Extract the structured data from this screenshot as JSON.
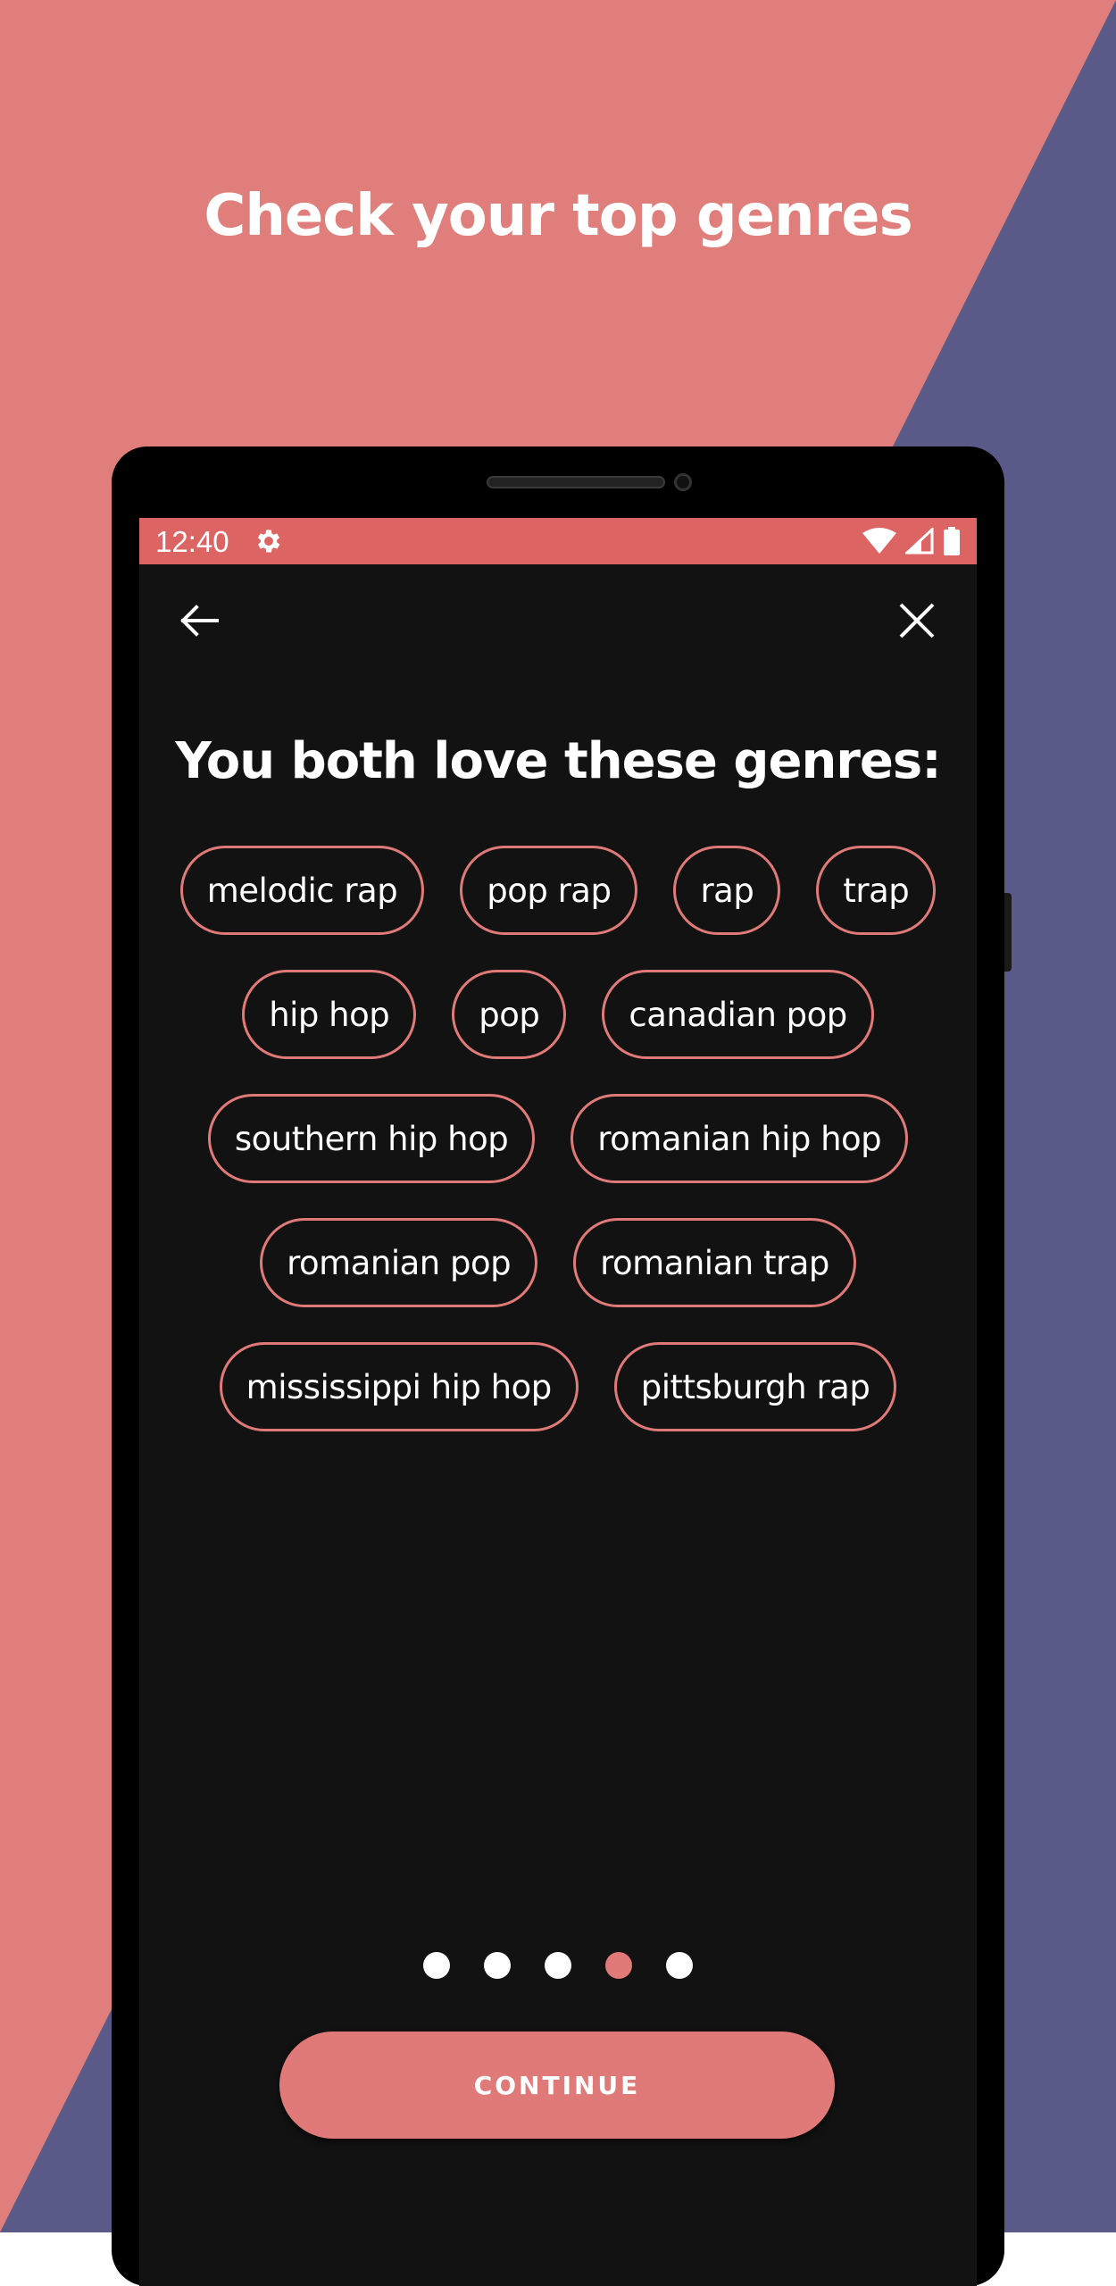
{
  "colors": {
    "background_pink": "#e07e7b",
    "background_purple": "#5a5a88",
    "status_bar": "#dc6463",
    "accent": "#e07a78",
    "screen_bg": "#121212"
  },
  "headline": "Check your top genres",
  "status_bar": {
    "time": "12:40",
    "icons": [
      "settings-icon",
      "wifi-icon",
      "signal-icon",
      "battery-icon"
    ]
  },
  "top_bar": {
    "back_icon": "arrow-left-icon",
    "close_icon": "close-icon"
  },
  "title": "You both love these genres:",
  "genres": [
    "melodic rap",
    "pop rap",
    "rap",
    "trap",
    "hip hop",
    "pop",
    "canadian pop",
    "southern hip hop",
    "romanian hip hop",
    "romanian pop",
    "romanian trap",
    "mississippi hip hop",
    "pittsburgh rap"
  ],
  "pagination": {
    "total": 5,
    "current": 4
  },
  "continue_label": "CONTINUE"
}
